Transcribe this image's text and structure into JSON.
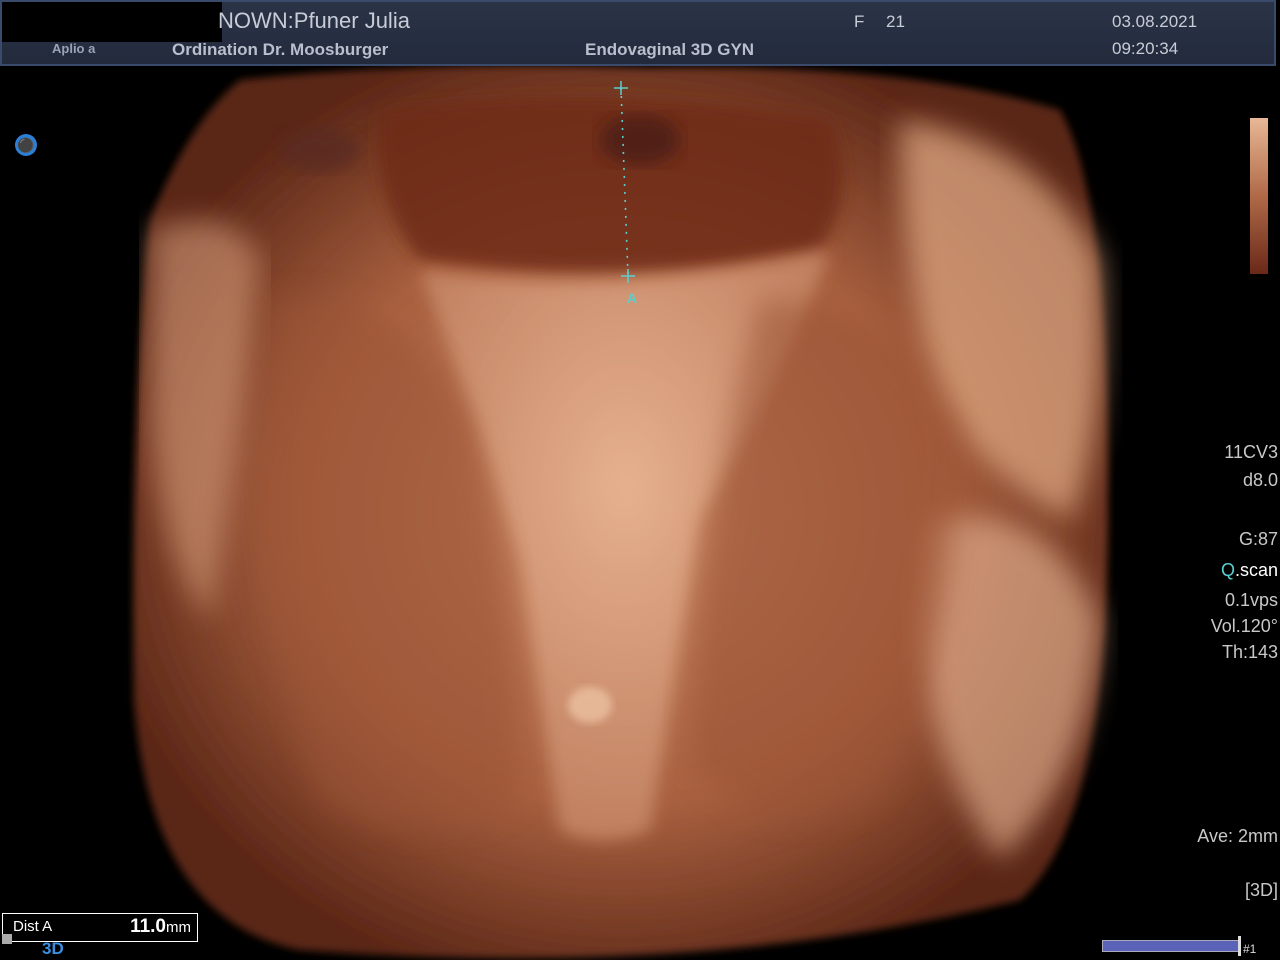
{
  "header": {
    "patient": "NOWN:Pfuner Julia",
    "sex": "F",
    "age": "21",
    "date": "03.08.2021",
    "time": "09:20:34",
    "system": "Aplio a",
    "institution": "Ordination Dr. Moosburger",
    "preset": "Endovaginal 3D GYN"
  },
  "parameters": {
    "probe": "11CV3",
    "depth": "d8.0",
    "gain": "G:87",
    "qscan_prefix": "Q",
    "qscan_suffix": ".scan",
    "vps": "0.1vps",
    "volume": "Vol.120°",
    "threshold": "Th:143",
    "average": "Ave: 2mm",
    "mode_tag": "[3D]"
  },
  "measurement": {
    "marker": "A",
    "label": "Dist A",
    "value": "11.0",
    "unit": "mm"
  },
  "footer": {
    "mode": "3D",
    "cine_index": "#1"
  },
  "colors": {
    "accent_blue": "#3a8ee0",
    "caliper_cyan": "#5ad0d0",
    "tissue_light": "#e8b896",
    "tissue_dark": "#6a2818"
  },
  "icons": {
    "probe_orientation": "probe-orientation-icon"
  }
}
